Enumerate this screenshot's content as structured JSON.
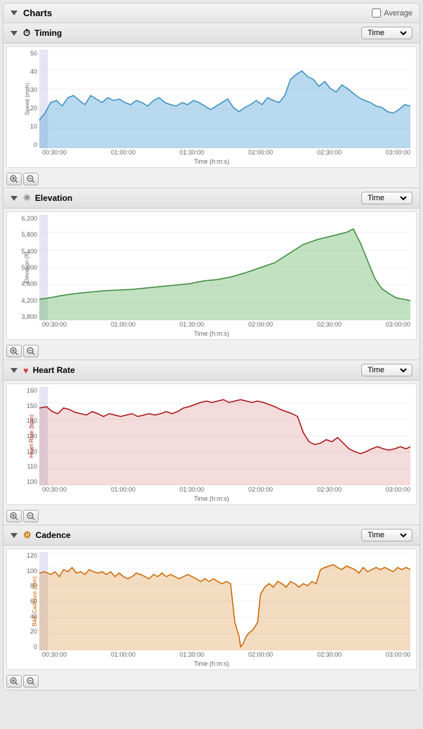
{
  "header": {
    "title": "Charts",
    "average_label": "Average",
    "triangle": "▼"
  },
  "sections": [
    {
      "id": "timing",
      "title": "Timing",
      "icon": "clock-icon",
      "icon_char": "⏱",
      "time_select": "Time",
      "y_axis": {
        "label": "Speed (mph)",
        "values": [
          "50",
          "40",
          "30",
          "20",
          "10",
          "0"
        ]
      },
      "x_axis": {
        "values": [
          "00:30:00",
          "01:00:00",
          "01:30:00",
          "02:00:00",
          "02:30:00",
          "03:00:00"
        ],
        "title": "Time (h:m:s)"
      },
      "color": "blue"
    },
    {
      "id": "elevation",
      "title": "Elevation",
      "icon": "elevation-icon",
      "icon_char": "✳",
      "time_select": "Time",
      "y_axis": {
        "label": "Elevation (ft)",
        "values": [
          "6,200",
          "5,800",
          "5,400",
          "5,000",
          "4,600",
          "4,200",
          "3,800"
        ]
      },
      "x_axis": {
        "values": [
          "00:30:00",
          "01:00:00",
          "01:30:00",
          "02:00:00",
          "02:30:00",
          "03:00:00"
        ],
        "title": "Time (h:m:s)"
      },
      "color": "green"
    },
    {
      "id": "heartrate",
      "title": "Heart Rate",
      "icon": "heart-icon",
      "icon_char": "♥",
      "time_select": "Time",
      "y_axis": {
        "label": "Heart Rate (bpm)",
        "values": [
          "160",
          "150",
          "140",
          "130",
          "120",
          "110",
          "100"
        ]
      },
      "x_axis": {
        "values": [
          "00:30:00",
          "01:00:00",
          "01:30:00",
          "02:00:00",
          "02:30:00",
          "03:00:00"
        ],
        "title": "Time (h:m:s)"
      },
      "color": "red"
    },
    {
      "id": "cadence",
      "title": "Cadence",
      "icon": "cadence-icon",
      "icon_char": "⚙",
      "time_select": "Time",
      "y_axis": {
        "label": "Bike Cadence (rpm)",
        "values": [
          "120",
          "100",
          "80",
          "60",
          "40",
          "20",
          "0"
        ]
      },
      "x_axis": {
        "values": [
          "00:30:00",
          "01:00:00",
          "01:30:00",
          "02:00:00",
          "02:30:00",
          "03:00:00"
        ],
        "title": "Time (h:m:s)"
      },
      "color": "orange"
    }
  ],
  "zoom": {
    "in_label": "🔍",
    "out_label": "🔎"
  }
}
